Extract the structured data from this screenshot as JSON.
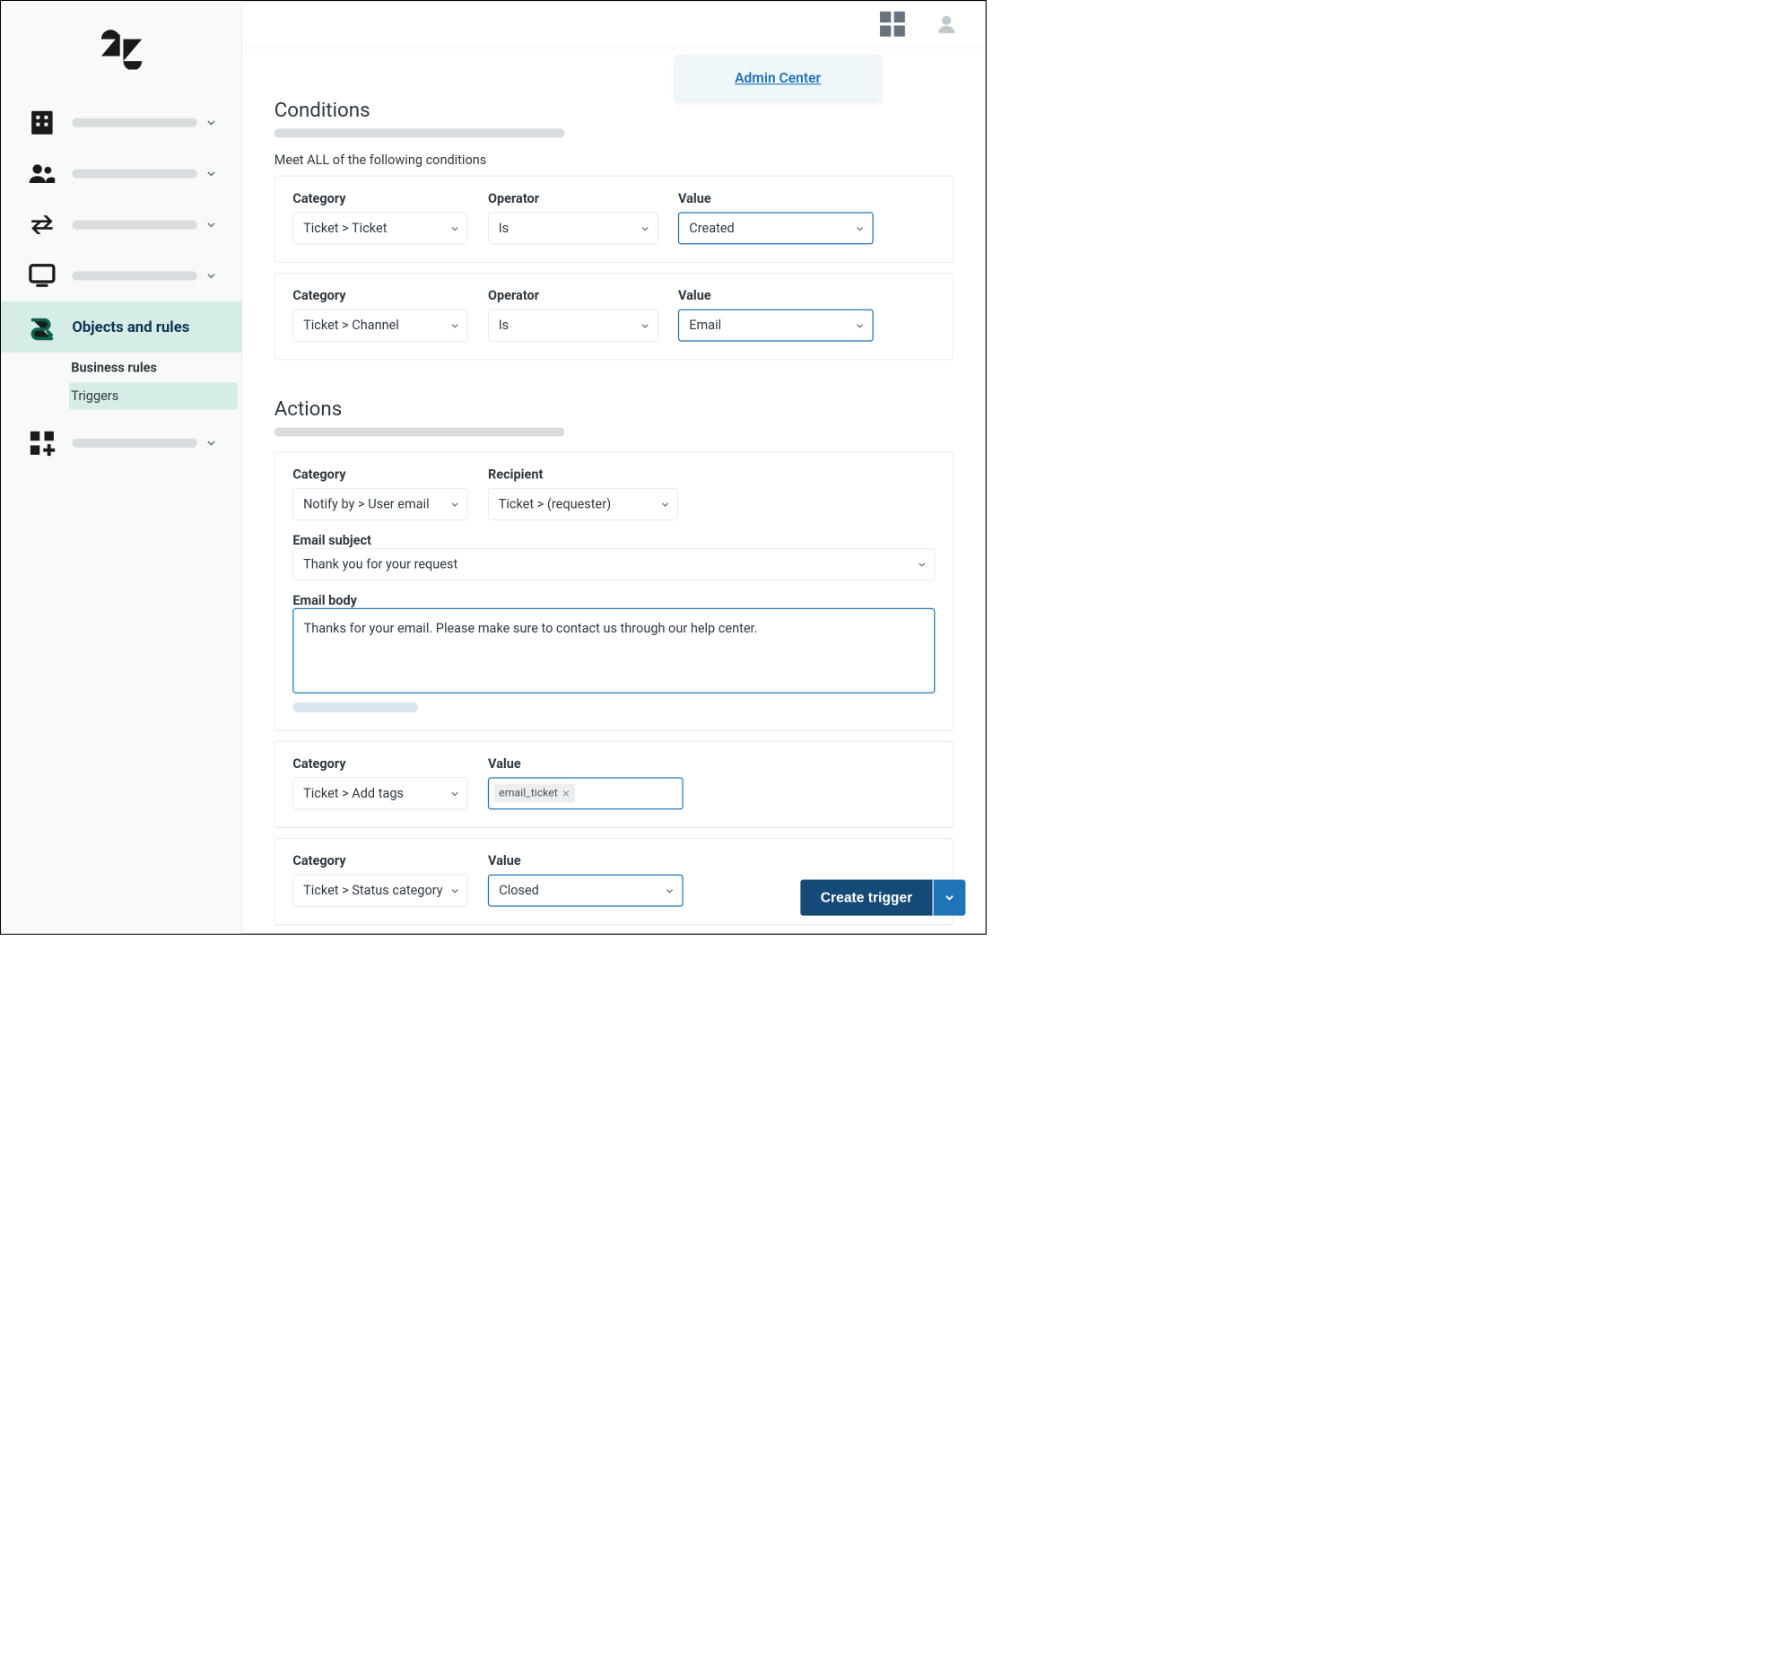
{
  "sidebar": {
    "active": {
      "label": "Objects and rules",
      "sub_heading": "Business rules",
      "sub_item": "Triggers"
    }
  },
  "topbar": {
    "admin_link": "Admin Center"
  },
  "conditions": {
    "title": "Conditions",
    "subtitle": "Meet ALL of the following conditions",
    "labels": {
      "category": "Category",
      "operator": "Operator",
      "value": "Value"
    },
    "rows": [
      {
        "category": "Ticket > Ticket",
        "operator": "Is",
        "value": "Created"
      },
      {
        "category": "Ticket > Channel",
        "operator": "Is",
        "value": "Email"
      }
    ]
  },
  "actions": {
    "title": "Actions",
    "labels": {
      "category": "Category",
      "recipient": "Recipient",
      "email_subject": "Email subject",
      "email_body": "Email body",
      "value": "Value"
    },
    "notify": {
      "category": "Notify by > User email",
      "recipient": "Ticket > (requester)"
    },
    "email_subject": "Thank you for your request",
    "email_body": "Thanks for your email. Please make sure to contact us through our help center.",
    "add_tags": {
      "category": "Ticket > Add tags",
      "tag": "email_ticket"
    },
    "status": {
      "category": "Ticket > Status category",
      "value": "Closed"
    }
  },
  "footer": {
    "create_trigger": "Create trigger"
  }
}
